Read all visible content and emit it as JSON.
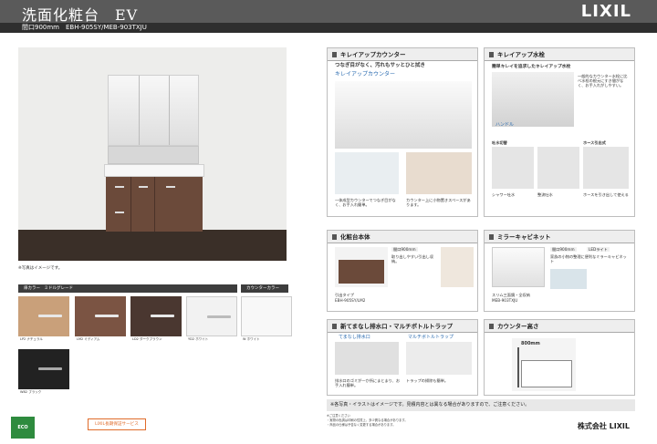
{
  "header": {
    "title": "洗面化粧台　EV",
    "logo": "LIXIL"
  },
  "subbar": {
    "text": "間口900mm　EBH-905SY/MEB-903TXJU"
  },
  "main": {
    "caption": "※写真はイメージです。"
  },
  "colors": {
    "section_label": "扉カラー　ミドルグレード",
    "counter_label": "カウンターカラー",
    "swatches": [
      {
        "code": "LP2",
        "name": "ナチュラル",
        "color": "#c9a07a"
      },
      {
        "code": "LM2",
        "name": "ミディアム",
        "color": "#7b5443"
      },
      {
        "code": "LD2",
        "name": "ダークブラウン",
        "color": "#4a3730"
      },
      {
        "code": "YD2",
        "name": "ホワイト",
        "color": "#f2f2f2"
      },
      {
        "code": "W",
        "name": "ホワイト",
        "color": "#f8f8f8"
      },
      {
        "code": "WB2",
        "name": "ブラック",
        "color": "#222222"
      }
    ]
  },
  "panels": {
    "counter": {
      "title": "キレイアップカウンター",
      "lead": "つなぎ目がなく、汚れもサッとひと拭き",
      "brand": "キレイアップカウンター",
      "note1": "一体成型カウンターでつなぎ目がなく、お手入れ簡単。",
      "note2": "カウンター上に小物置きスペースがあります。"
    },
    "faucet": {
      "title": "キレイアップ水栓",
      "lead": "簡単キレイを追求したキレイアップ水栓",
      "desc": "一般的なカウンター水栓に比べ水栓の根元にすき間がなく、お手入れがしやすい。",
      "brand": "ハンドル",
      "label1": "吐水切替",
      "label2": "ホース引出式",
      "sub1": "シャワー吐水",
      "sub2": "整流吐水",
      "sub3": "ホースを引き出して使える"
    },
    "cabinet": {
      "title": "化粧台本体",
      "tag": "間口900mm",
      "desc": "取り出しやすい引出し収納。",
      "model": "引出タイプ",
      "model_code": "EBH-905SY/LM2"
    },
    "mirror": {
      "title": "ミラーキャビネット",
      "tag1": "間口900mm",
      "tag2": "LEDライト",
      "desc": "家族の小物の整理に便利なミラーキャビネット",
      "model": "スリム三面鏡・全収納",
      "model_code": "MEB-903TXJU"
    },
    "trap": {
      "title": "新てまなし排水口・マルチボトルトラップ",
      "brand1": "てまなし排水口",
      "brand2": "マルチボトルトラップ",
      "note1": "排水口のゴミが一か所にまとまり、お手入れ簡単。",
      "note2": "トラップの掃除も簡単。"
    },
    "height": {
      "title": "カウンター高さ",
      "value": "800mm"
    }
  },
  "notebar": "※各写真・イラストはイメージです。見積内容とは異なる場合がありますので、ご注意ください。",
  "footer": {
    "badge1": "ECO",
    "badge2": "LIXIL長期保証サービス",
    "fine1": "※ご注意ください",
    "fine2": "・実物の色調は印刷の性質上、多少異なる場合があります。",
    "fine3": "・商品の仕様は予告なく変更する場合があります。",
    "company": "株式会社 LIXIL"
  }
}
